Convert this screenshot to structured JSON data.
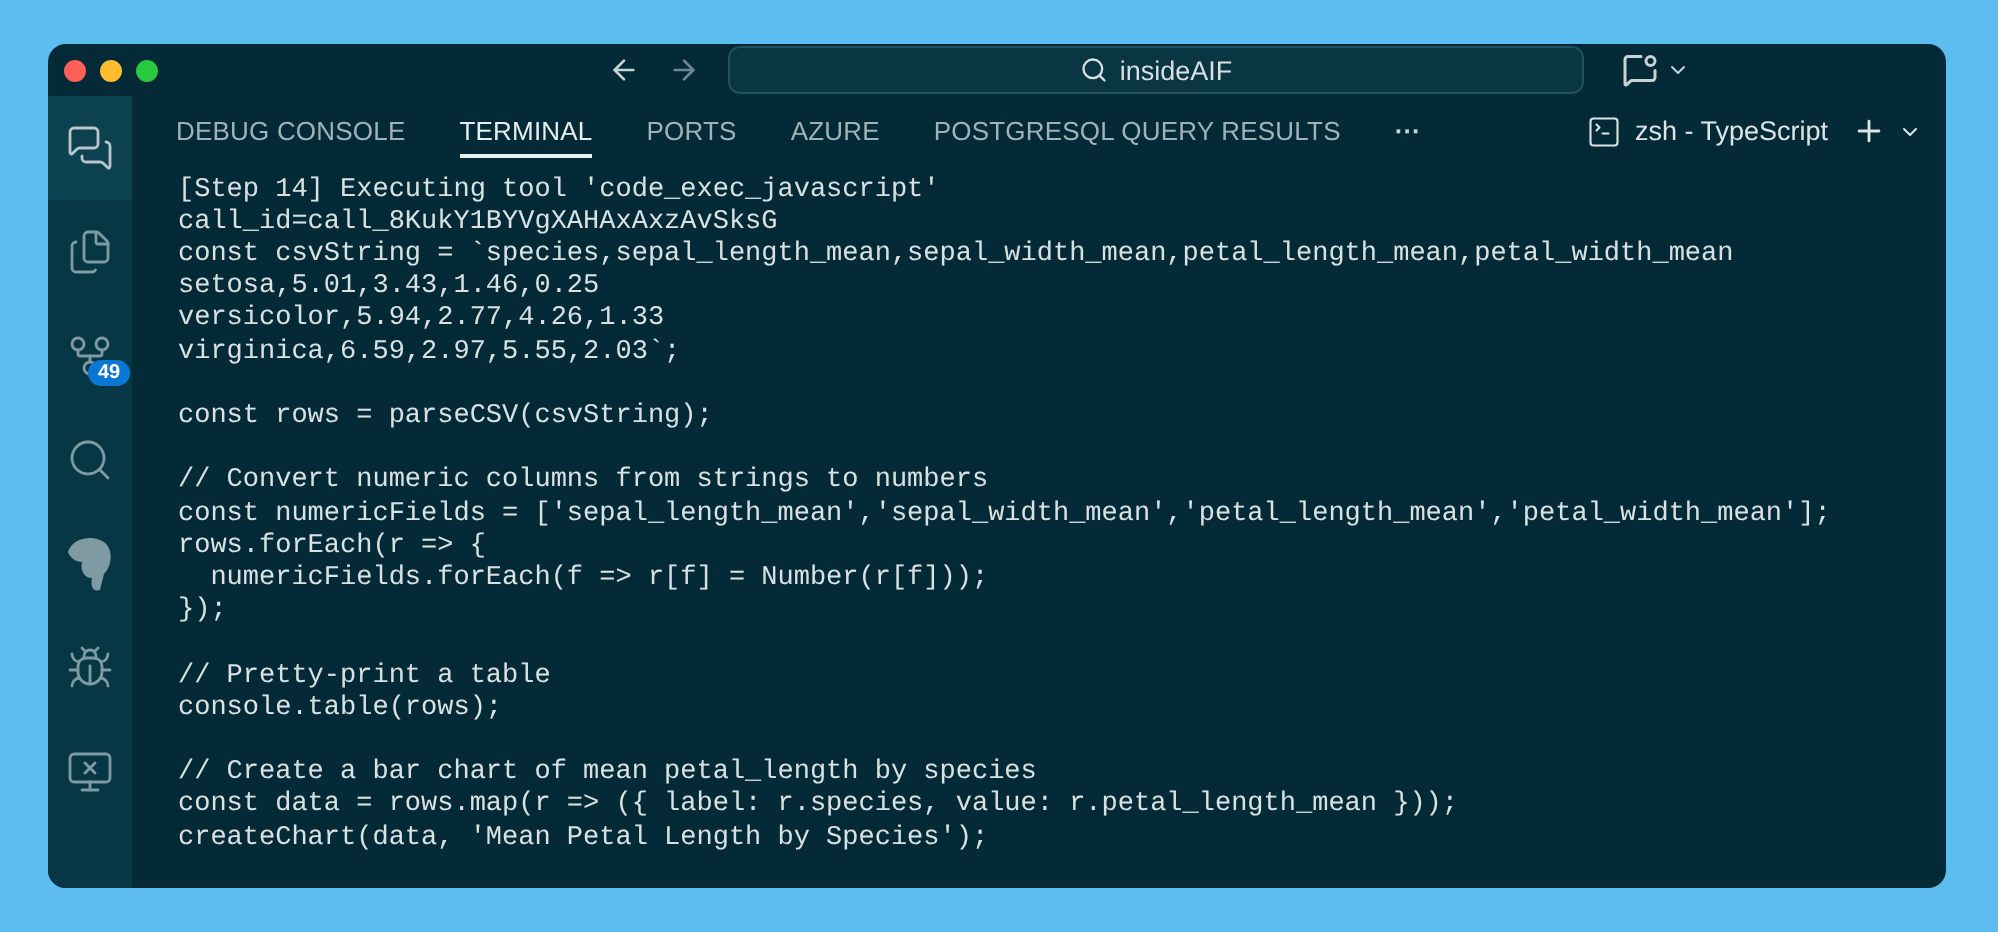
{
  "title_bar": {
    "search": {
      "value": "insideAIF"
    }
  },
  "activity_bar": {
    "items": [
      {
        "kind": "chat",
        "selected": true
      },
      {
        "kind": "files",
        "selected": false
      },
      {
        "kind": "source-control",
        "selected": false,
        "badge": "49"
      },
      {
        "kind": "search",
        "selected": false
      },
      {
        "kind": "database",
        "selected": false
      },
      {
        "kind": "debug",
        "selected": false
      },
      {
        "kind": "remote",
        "selected": false
      }
    ]
  },
  "panel": {
    "tabs": [
      {
        "label": "DEBUG CONSOLE",
        "selected": false
      },
      {
        "label": "TERMINAL",
        "selected": true
      },
      {
        "label": "PORTS",
        "selected": false
      },
      {
        "label": "AZURE",
        "selected": false
      },
      {
        "label": "POSTGRESQL QUERY RESULTS",
        "selected": false
      }
    ],
    "more": "···",
    "terminal_name": "zsh - TypeScript",
    "output": [
      [
        "[Step 14] Executing tool 'code_exec_javascript'",
        "call_id=call_8KukY1BYVgXAHAxAxzAvSksG",
        "const csvString = `species,sepal_length_mean,sepal_width_mean,petal_length_mean,petal_width_mean",
        "setosa,5.01,3.43,1.46,0.25",
        "versicolor,5.94,2.77,4.26,1.33",
        "virginica,6.59,2.97,5.55,2.03`;"
      ],
      [
        "const rows = parseCSV(csvString);"
      ],
      [
        "// Convert numeric columns from strings to numbers",
        "const numericFields = ['sepal_length_mean','sepal_width_mean','petal_length_mean','petal_width_mean'];",
        "rows.forEach(r => {",
        "  numericFields.forEach(f => r[f] = Number(r[f]));",
        "});"
      ],
      [
        "// Pretty-print a table",
        "console.table(rows);"
      ],
      [
        "// Create a bar chart of mean petal_length by species",
        "const data = rows.map(r => ({ label: r.species, value: r.petal_length_mean }));",
        "createChart(data, 'Mean Petal Length by Species');"
      ]
    ]
  }
}
